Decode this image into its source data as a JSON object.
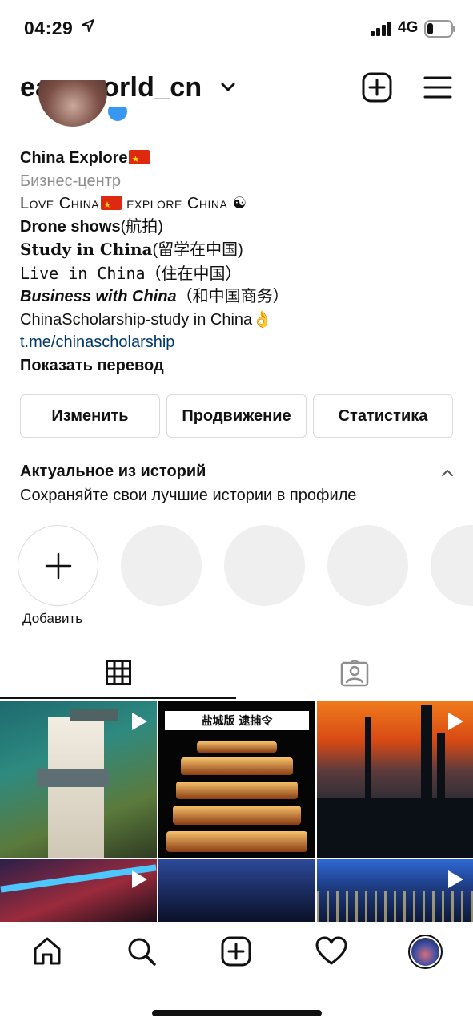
{
  "status_bar": {
    "time": "04:29",
    "network": "4G",
    "location_icon": "location-arrow-icon",
    "signal_icon": "signal-bars-icon",
    "battery_icon": "battery-low-icon"
  },
  "header": {
    "username": "easyworld_cn",
    "chevron_icon": "chevron-down-icon",
    "new_post_icon": "plus-square-icon",
    "menu_icon": "hamburger-menu-icon"
  },
  "bio": {
    "name": "China Explore",
    "category": "Бизнес-центр",
    "line1": "Love China",
    "line1b": " explore China ☯",
    "line2_bold": "Drone shows",
    "line2_rest": "(航拍)",
    "line3_styled": "Study in China",
    "line3_rest": "(留学在中国)",
    "line4_styled": "Live in China",
    "line4_rest": "（住在中国）",
    "line5_styled": "Business with China",
    "line5_rest": "（和中国商务）",
    "line6": "ChinaScholarship-study in China👌",
    "link": "t.me/chinascholarship",
    "translate": "Показать перевод"
  },
  "actions": {
    "edit": "Изменить",
    "promote": "Продвижение",
    "insights": "Статистика"
  },
  "highlights": {
    "title": "Актуальное из историй",
    "subtitle": "Сохраняйте свои лучшие истории в профиле",
    "add_label": "Добавить",
    "collapse_icon": "chevron-up-icon"
  },
  "tabs": {
    "grid_icon": "grid-icon",
    "tagged_icon": "tagged-user-icon"
  },
  "posts": [
    {
      "type": "video",
      "icon": "play-icon"
    },
    {
      "type": "video",
      "banner": "盐城版 逮捕令",
      "icon": "play-icon"
    },
    {
      "type": "video",
      "icon": "play-icon"
    },
    {
      "type": "video",
      "icon": "play-icon"
    },
    {
      "type": "video"
    },
    {
      "type": "video",
      "icon": "play-icon"
    }
  ],
  "bottom_nav": {
    "home_icon": "home-icon",
    "search_icon": "search-icon",
    "create_icon": "plus-square-icon",
    "activity_icon": "heart-icon",
    "profile_icon": "profile-avatar"
  }
}
